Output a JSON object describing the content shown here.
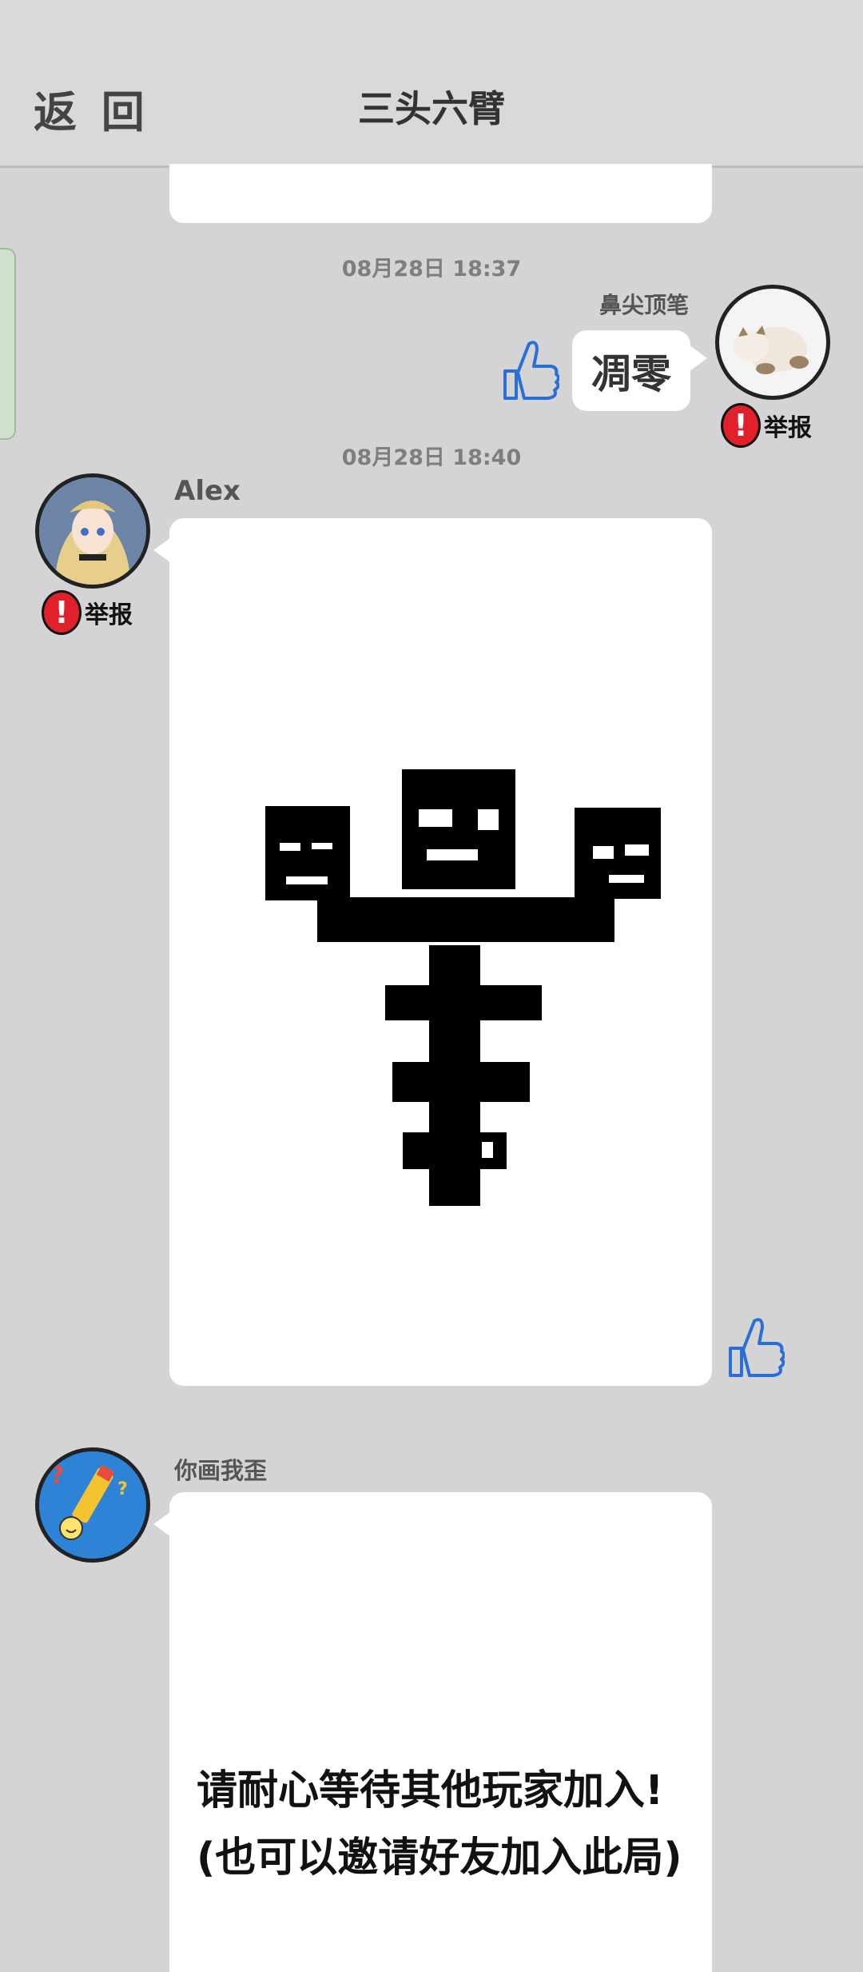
{
  "header": {
    "back_label": "返 回",
    "title": "三头六臂"
  },
  "messages": [
    {
      "timestamp": "08月28日  18:37",
      "sender": "鼻尖顶笔",
      "text": "凋零",
      "report_label": "举报"
    },
    {
      "timestamp": "08月28日  18:40",
      "sender": "Alex",
      "report_label": "举报"
    },
    {
      "sender": "你画我歪",
      "waiting_line1": "请耐心等待其他玩家加入!",
      "waiting_line2": "(也可以邀请好友加入此局)"
    }
  ]
}
